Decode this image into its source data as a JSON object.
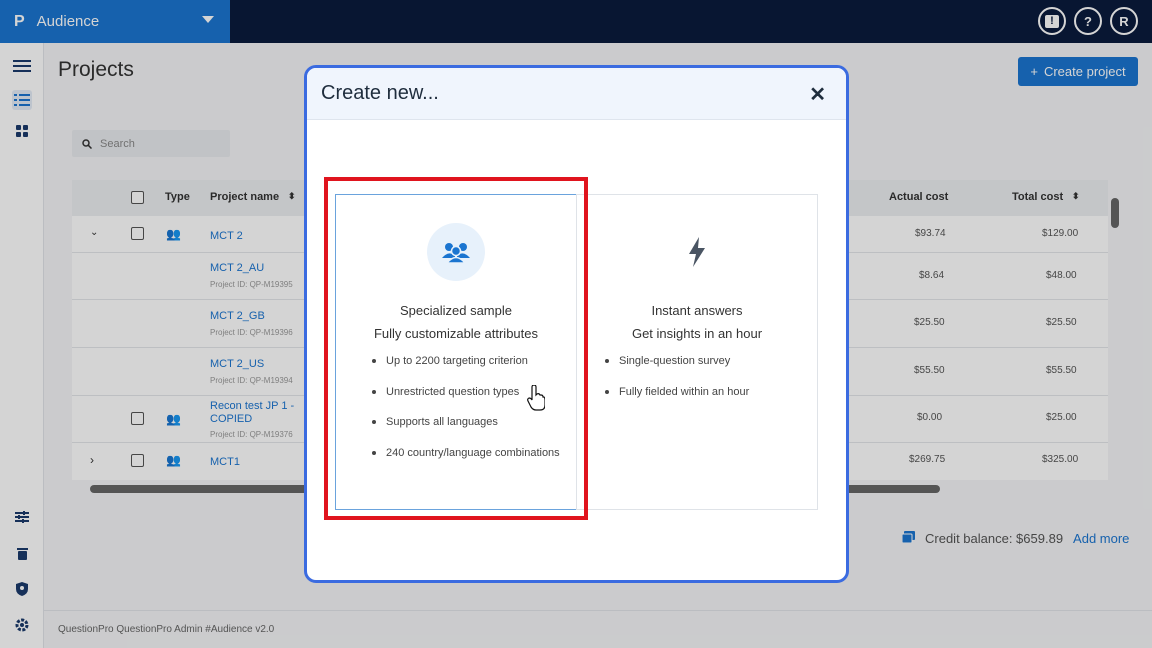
{
  "app": {
    "logo": "P",
    "name": "Audience",
    "user_initial": "R"
  },
  "page": {
    "title": "Projects",
    "create_button": "Create project",
    "search_placeholder": "Search"
  },
  "table": {
    "headers": {
      "type": "Type",
      "project_name": "Project name",
      "actual_cost": "Actual cost",
      "total_cost": "Total cost"
    },
    "rows": [
      {
        "name": "MCT 2",
        "sub": "",
        "actual": "$93.74",
        "total": "$129.00"
      },
      {
        "name": "MCT 2_AU",
        "sub": "Project ID: QP-M19395",
        "actual": "$8.64",
        "total": "$48.00"
      },
      {
        "name": "MCT 2_GB",
        "sub": "Project ID: QP-M19396",
        "actual": "$25.50",
        "total": "$25.50"
      },
      {
        "name": "MCT 2_US",
        "sub": "Project ID: QP-M19394",
        "actual": "$55.50",
        "total": "$55.50"
      },
      {
        "name": "Recon test JP 1 - COPIED",
        "sub": "Project ID: QP-M19376",
        "actual": "$0.00",
        "total": "$25.00"
      },
      {
        "name": "MCT1",
        "sub": "",
        "actual": "$269.75",
        "total": "$325.00"
      }
    ]
  },
  "credit": {
    "label": "Credit balance: $659.89",
    "add_more": "Add more"
  },
  "footer": {
    "text": "QuestionPro QuestionPro Admin  #Audience v2.0"
  },
  "modal": {
    "title": "Create new...",
    "close": "✕",
    "cards": [
      {
        "title": "Specialized sample",
        "subtitle": "Fully customizable attributes",
        "icon": "users-icon",
        "bullets": [
          "Up to 2200 targeting criterion",
          "Unrestricted question types",
          "Supports all languages",
          "240 country/language combinations"
        ]
      },
      {
        "title": "Instant answers",
        "subtitle": "Get insights in an hour",
        "icon": "lightning-icon",
        "bullets": [
          "Single-question survey",
          "Fully fielded within an hour"
        ]
      }
    ]
  },
  "colors": {
    "brand": "#1b75d0",
    "topbar": "#0a1b3d",
    "highlight": "#e0141e",
    "modal_border": "#3b6be0"
  }
}
